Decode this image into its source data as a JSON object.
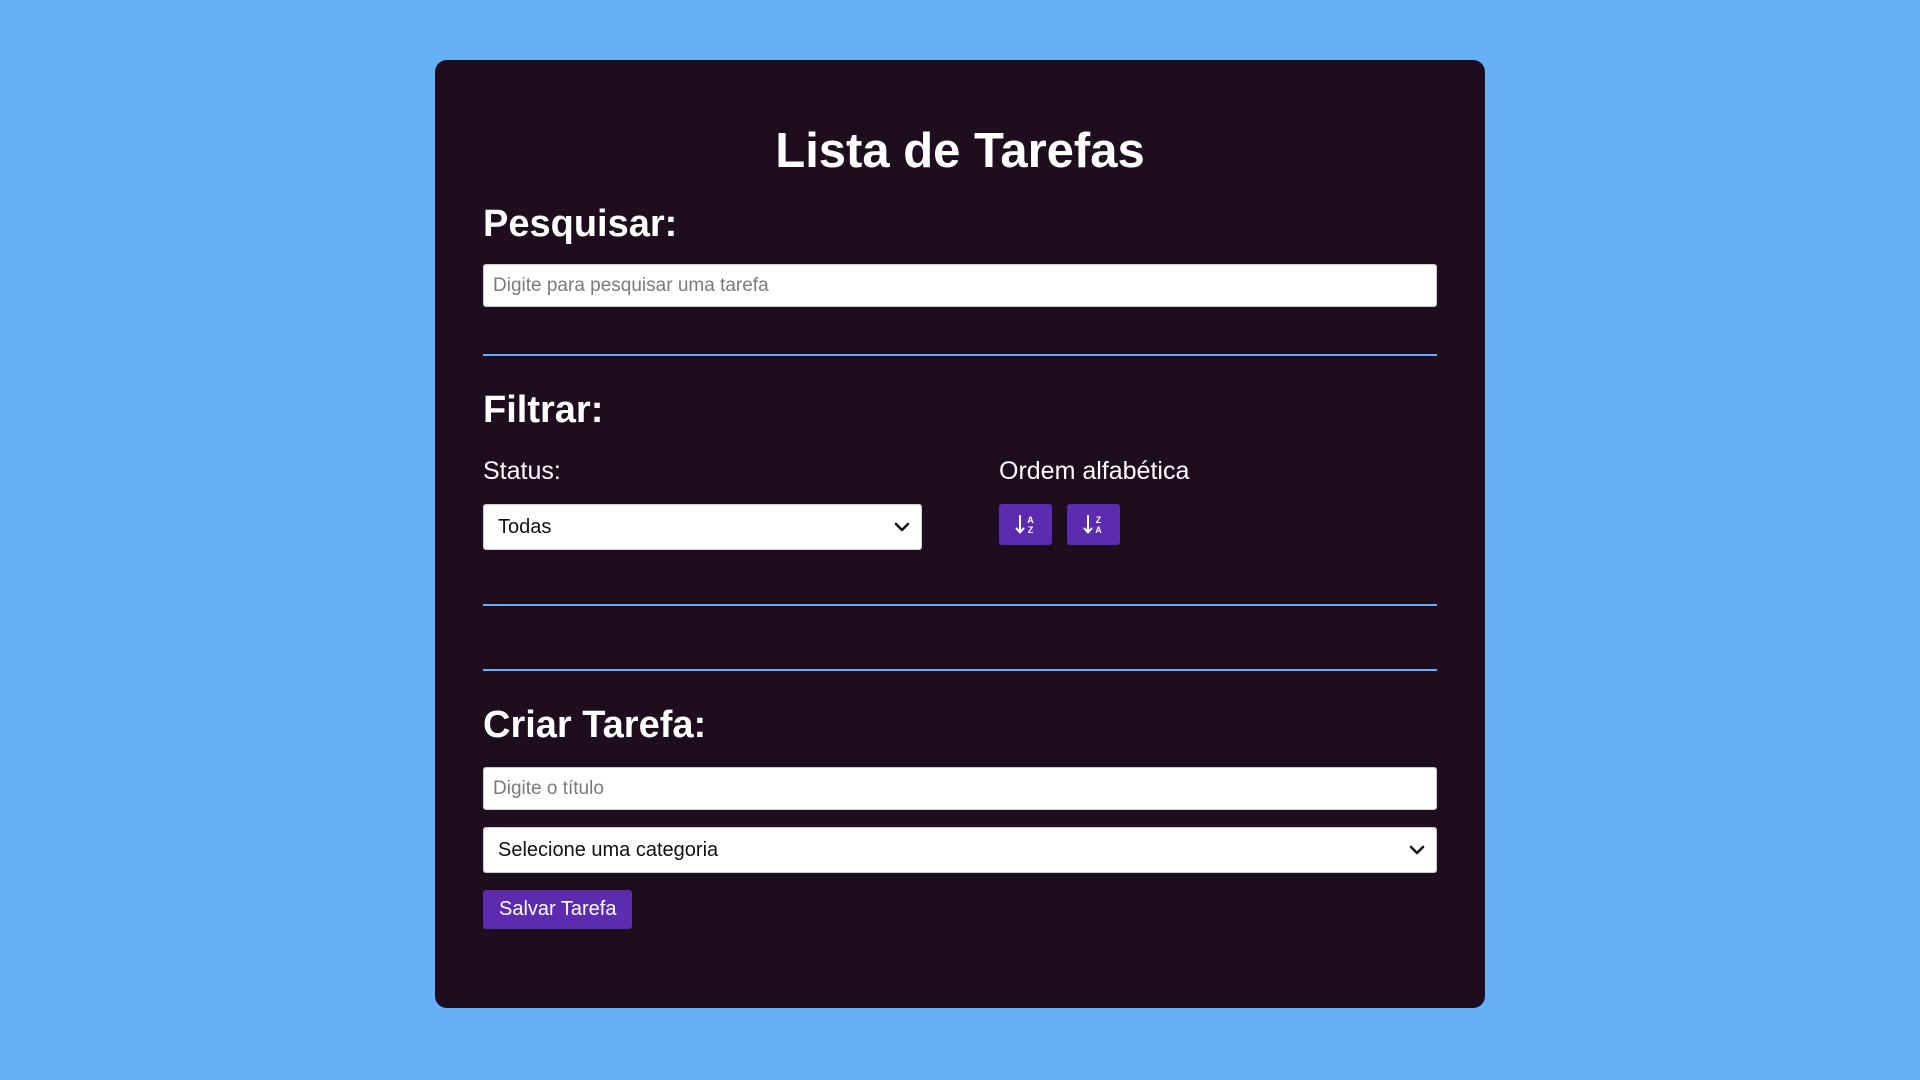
{
  "app": {
    "title": "Lista de Tarefas"
  },
  "search": {
    "heading": "Pesquisar:",
    "placeholder": "Digite para pesquisar uma tarefa",
    "value": ""
  },
  "filter": {
    "heading": "Filtrar:",
    "status_label": "Status:",
    "status_selected": "Todas",
    "order_label": "Ordem alfabética",
    "sort_asc_icon": "sort-alpha-asc-icon",
    "sort_desc_icon": "sort-alpha-desc-icon"
  },
  "create": {
    "heading": "Criar Tarefa:",
    "title_placeholder": "Digite o título",
    "title_value": "",
    "category_selected": "Selecione uma categoria",
    "save_label": "Salvar Tarefa"
  },
  "colors": {
    "background": "#65b0f6",
    "card": "#1e0c1f",
    "accent": "#5c2bb0",
    "divider": "#65b0f6"
  }
}
